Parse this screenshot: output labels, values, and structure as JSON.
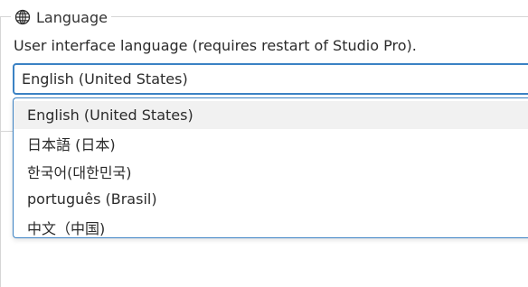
{
  "group": {
    "title": "Language",
    "icon": "globe-icon"
  },
  "language": {
    "description": "User interface language (requires restart of Studio Pro).",
    "selected": "English (United States)",
    "options": [
      "English (United States)",
      "日本語 (日本)",
      "한국어(대한민국)",
      "português (Brasil)",
      "中文（中国)"
    ]
  },
  "colors": {
    "accent": "#3b82c4",
    "border": "#d6d6d6",
    "selected_bg": "#f1f1f1"
  }
}
